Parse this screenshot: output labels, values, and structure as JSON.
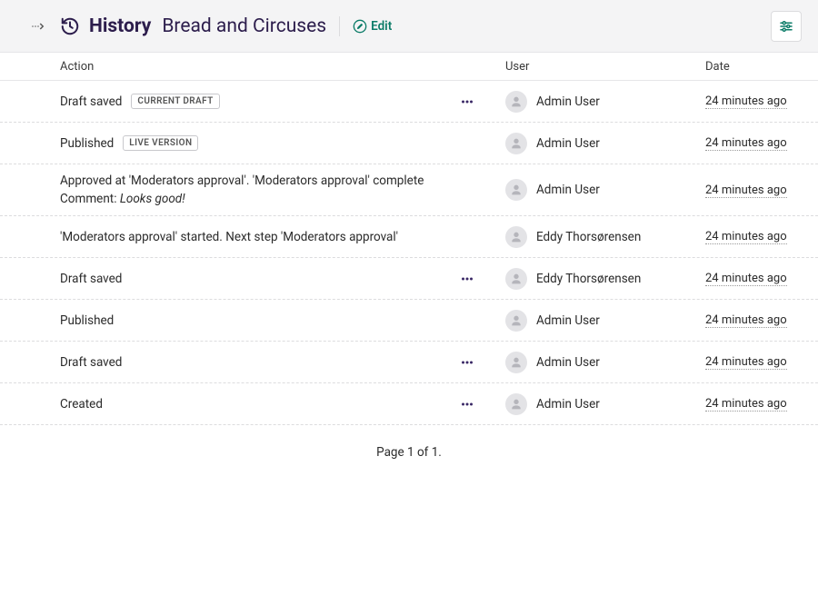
{
  "header": {
    "history_label": "History",
    "page_title": "Bread and Circuses",
    "edit_label": "Edit"
  },
  "columns": {
    "action": "Action",
    "user": "User",
    "date": "Date"
  },
  "rows": [
    {
      "action": "Draft saved",
      "tag": "CURRENT DRAFT",
      "has_dots": true,
      "user": "Admin User",
      "date": "24 minutes ago"
    },
    {
      "action": "Published",
      "tag": "LIVE VERSION",
      "has_dots": false,
      "user": "Admin User",
      "date": "24 minutes ago"
    },
    {
      "action": "Approved at 'Moderators approval'. 'Moderators approval' complete",
      "comment_label": "Comment: ",
      "comment_text": "Looks good!",
      "has_dots": false,
      "user": "Admin User",
      "date": "24 minutes ago"
    },
    {
      "action": "'Moderators approval' started. Next step 'Moderators approval'",
      "has_dots": false,
      "user": "Eddy Thorsørensen",
      "date": "24 minutes ago"
    },
    {
      "action": "Draft saved",
      "has_dots": true,
      "user": "Eddy Thorsørensen",
      "date": "24 minutes ago"
    },
    {
      "action": "Published",
      "has_dots": false,
      "user": "Admin User",
      "date": "24 minutes ago"
    },
    {
      "action": "Draft saved",
      "has_dots": true,
      "user": "Admin User",
      "date": "24 minutes ago"
    },
    {
      "action": "Created",
      "has_dots": true,
      "user": "Admin User",
      "date": "24 minutes ago"
    }
  ],
  "pager": "Page 1 of 1."
}
